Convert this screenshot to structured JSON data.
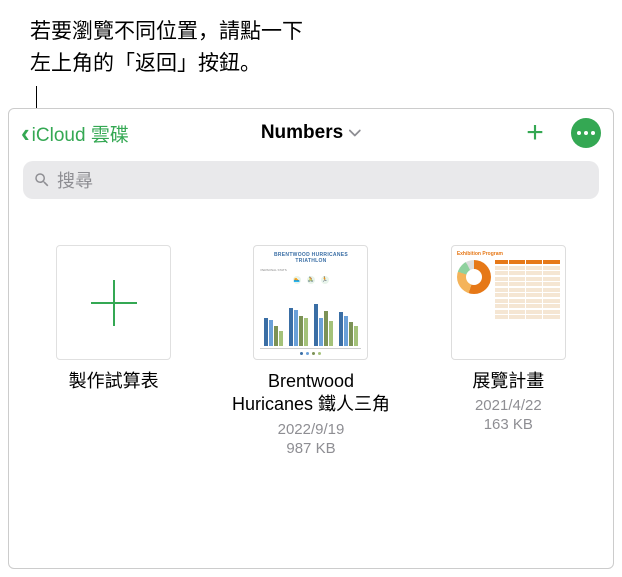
{
  "annotation": {
    "line1": "若要瀏覽不同位置，請點一下",
    "line2": "左上角的「返回」按鈕。"
  },
  "nav": {
    "back_label": "iCloud 雲碟",
    "title": "Numbers",
    "icons": {
      "back": "back-chevron",
      "dropdown": "chevron-down",
      "add": "plus",
      "more": "ellipsis-circle"
    }
  },
  "search": {
    "placeholder": "搜尋"
  },
  "items": [
    {
      "type": "create",
      "name": "製作試算表"
    },
    {
      "type": "doc",
      "name": "Brentwood Huricanes 鐵人三角",
      "date": "2022/9/19",
      "size": "987 KB",
      "preview_title": "BRENTWOOD HURRICANES TRIATHLON"
    },
    {
      "type": "doc",
      "name": "展覽計畫",
      "date": "2021/4/22",
      "size": "163 KB",
      "preview_title": "Exhibition Program"
    }
  ],
  "colors": {
    "accent": "#34a853",
    "secondary_text": "#8e8e93",
    "search_bg": "#e9e9eb",
    "orange": "#e67817"
  }
}
